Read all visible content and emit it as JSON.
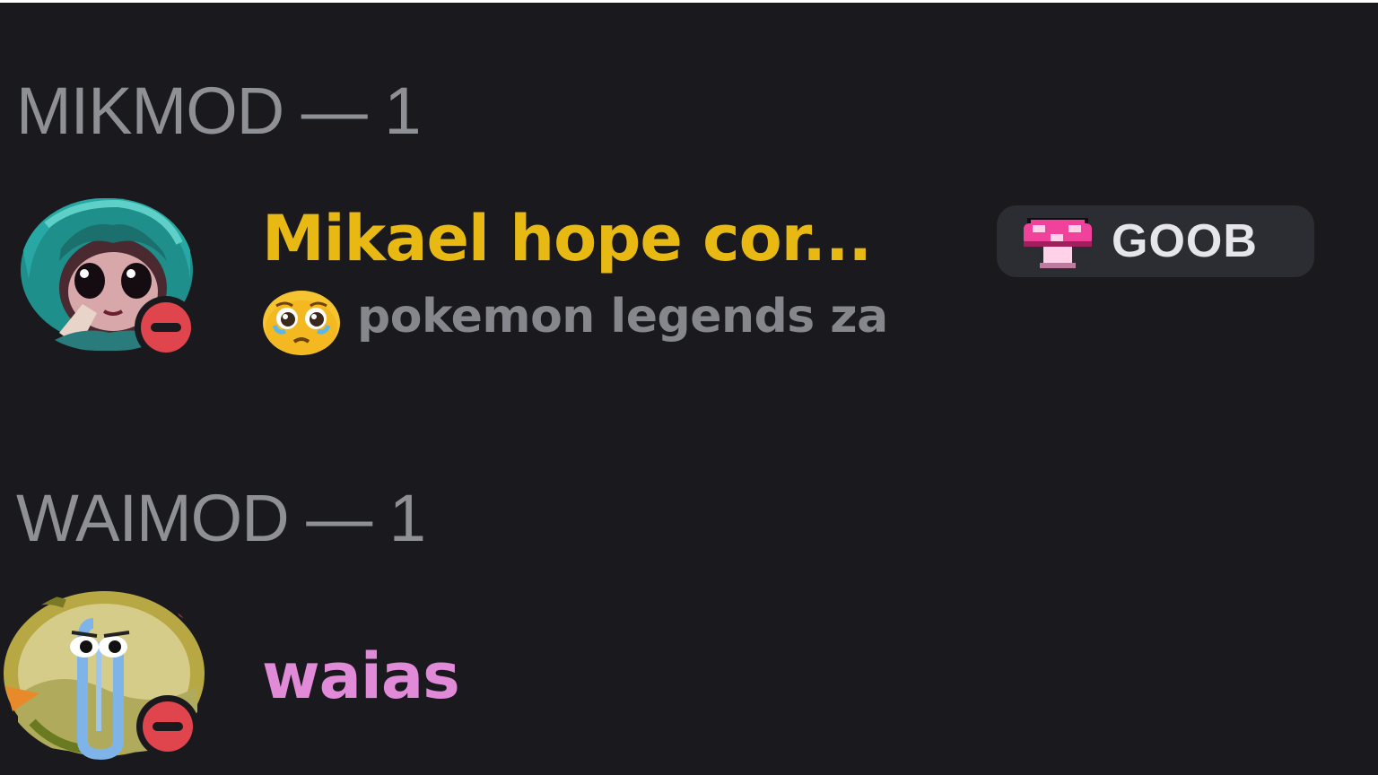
{
  "groups": [
    {
      "header": "MIKMOD — 1",
      "members": [
        {
          "name": "Mikael hope cor...",
          "name_color": "#e8b913",
          "status": "do-not-disturb",
          "tag": {
            "icon": "pink-mushroom-icon",
            "label": "GOOB"
          },
          "activity": {
            "emoji": "pleading-face-emoji",
            "text": "pokemon legends za"
          }
        }
      ]
    },
    {
      "header": "WAIMOD — 1",
      "members": [
        {
          "name": "waias",
          "name_color": "#e08ad8",
          "status": "do-not-disturb"
        }
      ]
    }
  ],
  "colors": {
    "background": "#1a1a1e",
    "header_text": "#8e9096",
    "dnd_red": "#e0444c",
    "activity_text": "#85878d",
    "tag_background": "#2c2d33"
  }
}
